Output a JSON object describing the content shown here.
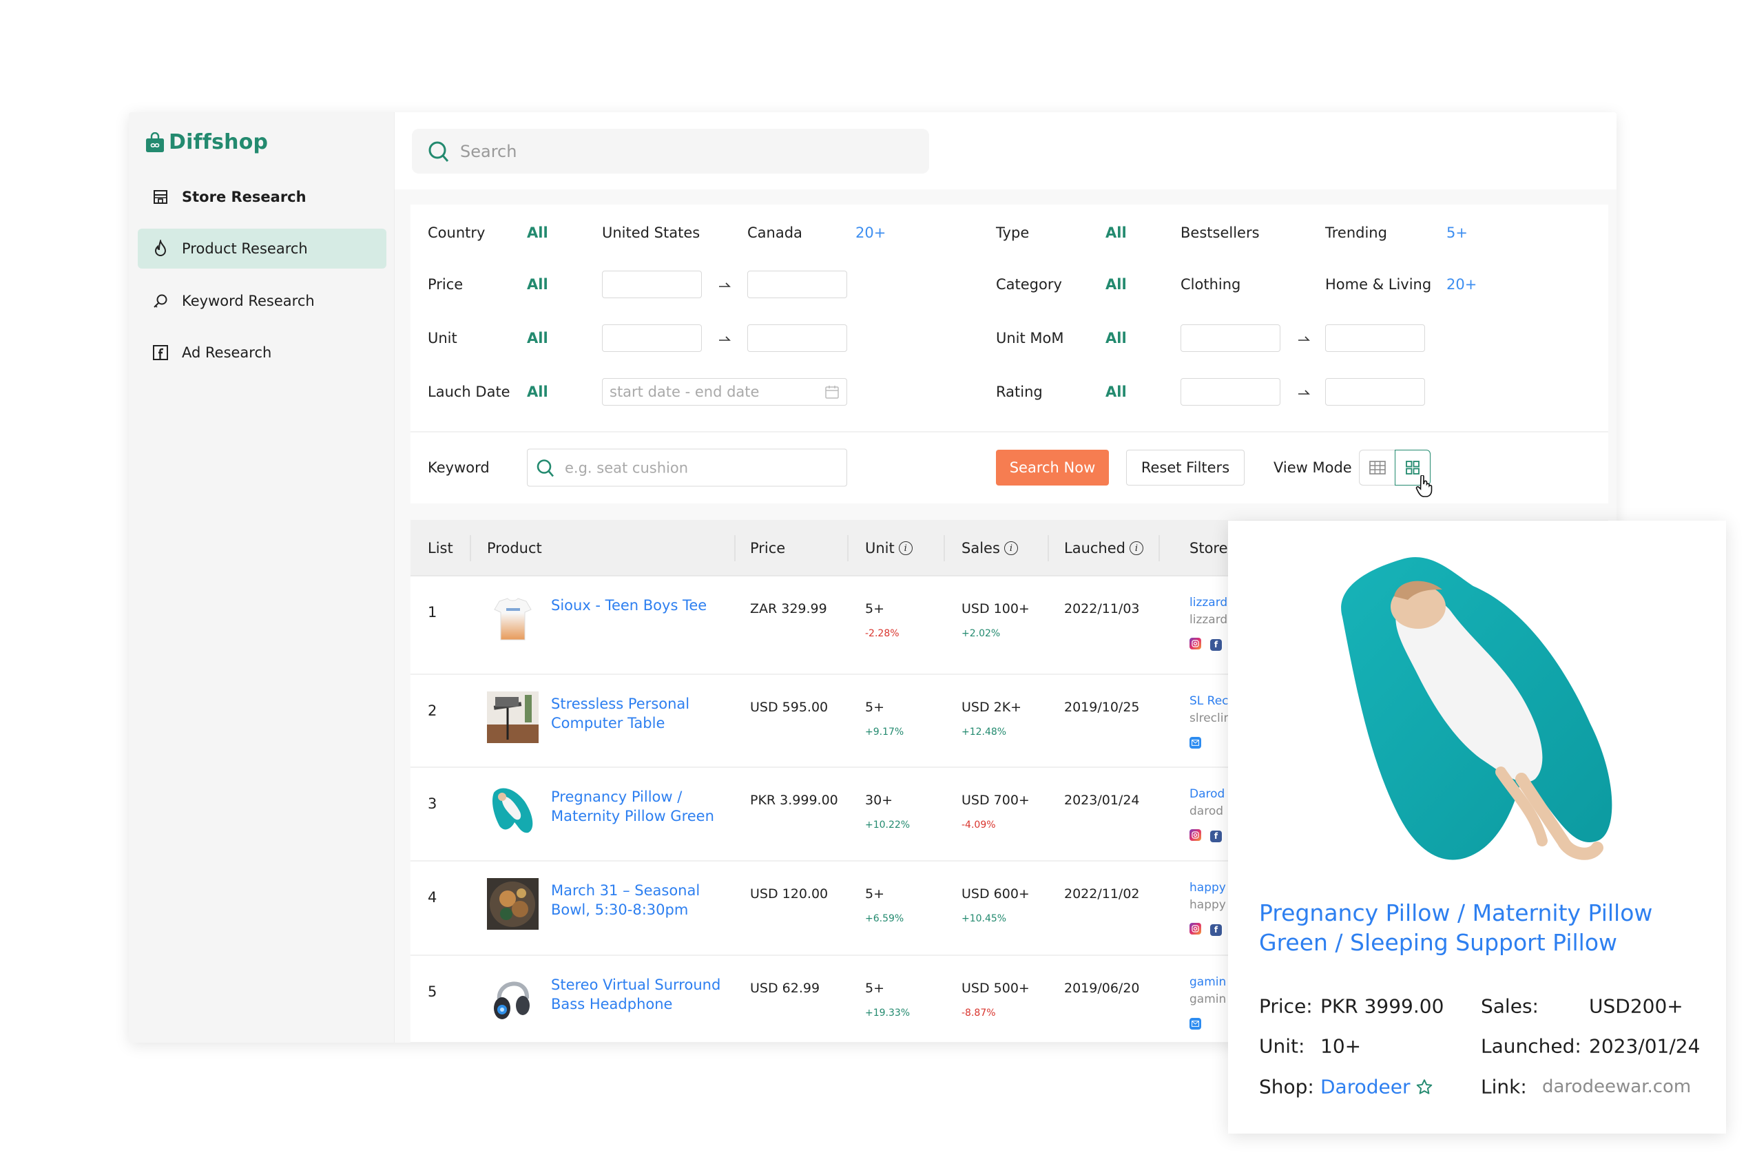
{
  "brand": {
    "name": "Diffshop",
    "color": "#238a6f"
  },
  "sidebar": {
    "items": [
      {
        "label": "Store Research",
        "icon": "store-icon",
        "active": false
      },
      {
        "label": "Product Research",
        "icon": "flame-icon",
        "active": true
      },
      {
        "label": "Keyword Research",
        "icon": "key-search-icon",
        "active": false
      },
      {
        "label": "Ad Research",
        "icon": "facebook-icon",
        "active": false
      }
    ]
  },
  "search": {
    "placeholder": "Search"
  },
  "filters": {
    "left": [
      {
        "label": "Country",
        "all": "All",
        "options": [
          "United States",
          "Canada"
        ],
        "more": "20+"
      },
      {
        "label": "Price",
        "all": "All",
        "range": true
      },
      {
        "label": "Unit",
        "all": "All",
        "range": true
      },
      {
        "label": "Lauch Date",
        "all": "All",
        "date_placeholder": "start date - end date"
      }
    ],
    "right": [
      {
        "label": "Type",
        "all": "All",
        "options": [
          "Bestsellers",
          "Trending"
        ],
        "more": "5+"
      },
      {
        "label": "Category",
        "all": "All",
        "options": [
          "Clothing",
          "Home & Living"
        ],
        "more": "20+"
      },
      {
        "label": "Unit MoM",
        "all": "All",
        "range": true
      },
      {
        "label": "Rating",
        "all": "All",
        "range": true
      }
    ],
    "keyword": {
      "label": "Keyword",
      "placeholder": "e.g. seat cushion"
    },
    "search_now": "Search Now",
    "reset": "Reset Filters",
    "view_mode": {
      "label": "View Mode",
      "options": [
        "table-view",
        "grid-view"
      ],
      "selected": "grid-view"
    }
  },
  "table": {
    "columns": [
      "List",
      "Product",
      "Price",
      "Unit",
      "Sales",
      "Lauched",
      "Store"
    ],
    "rows": [
      {
        "index": "1",
        "name": "Sioux - Teen Boys Tee",
        "price": "ZAR 329.99",
        "unit": "5+",
        "unit_change": "-2.28%",
        "unit_dir": "down",
        "sales": "USD 100+",
        "sales_change": "+2.02%",
        "sales_dir": "up",
        "launched": "2022/11/03",
        "store_name": "lizzard",
        "store_sub": "lizzard",
        "socials": [
          "instagram",
          "facebook"
        ]
      },
      {
        "index": "2",
        "name": "Stressless Personal Computer Table",
        "price": "USD 595.00",
        "unit": "5+",
        "unit_change": "+9.17%",
        "unit_dir": "up",
        "sales": "USD 2K+",
        "sales_change": "+12.48%",
        "sales_dir": "up",
        "launched": "2019/10/25",
        "store_name": "SL Rec",
        "store_sub": "slreclin",
        "socials": [
          "email"
        ]
      },
      {
        "index": "3",
        "name": "Pregnancy Pillow / Maternity Pillow Green",
        "price": "PKR 3.999.00",
        "unit": "30+",
        "unit_change": "+10.22%",
        "unit_dir": "up",
        "sales": "USD 700+",
        "sales_change": "-4.09%",
        "sales_dir": "down",
        "launched": "2023/01/24",
        "store_name": "Darod",
        "store_sub": "darod",
        "socials": [
          "instagram",
          "facebook"
        ]
      },
      {
        "index": "4",
        "name": "March 31 – Seasonal Bowl, 5:30-8:30pm",
        "price": "USD 120.00",
        "unit": "5+",
        "unit_change": "+6.59%",
        "unit_dir": "up",
        "sales": "USD 600+",
        "sales_change": "+10.45%",
        "sales_dir": "up",
        "launched": "2022/11/02",
        "store_name": "happy",
        "store_sub": "happy",
        "socials": [
          "instagram",
          "facebook"
        ]
      },
      {
        "index": "5",
        "name": "Stereo Virtual Surround Bass Headphone",
        "price": "USD 62.99",
        "unit": "5+",
        "unit_change": "+19.33%",
        "unit_dir": "up",
        "sales": "USD 500+",
        "sales_change": "-8.87%",
        "sales_dir": "down",
        "launched": "2019/06/20",
        "store_name": "gamin",
        "store_sub": "gamin",
        "socials": [
          "email"
        ]
      }
    ]
  },
  "popup": {
    "title": "Pregnancy Pillow / Maternity Pillow Green / Sleeping Support Pillow",
    "price_label": "Price:",
    "price": "PKR 3999.00",
    "sales_label": "Sales:",
    "sales": "USD200+",
    "unit_label": "Unit:",
    "unit": "10+",
    "launched_label": "Launched:",
    "launched": "2023/01/24",
    "shop_label": "Shop:",
    "shop": "Darodeer",
    "link_label": "Link:",
    "link": "darodeewar.com"
  },
  "colors": {
    "accent": "#238a6f",
    "link": "#2d7ff0",
    "primary_button": "#f67d51",
    "up": "#238a6f",
    "down": "#d9352e",
    "more": "#3d8ef0"
  }
}
